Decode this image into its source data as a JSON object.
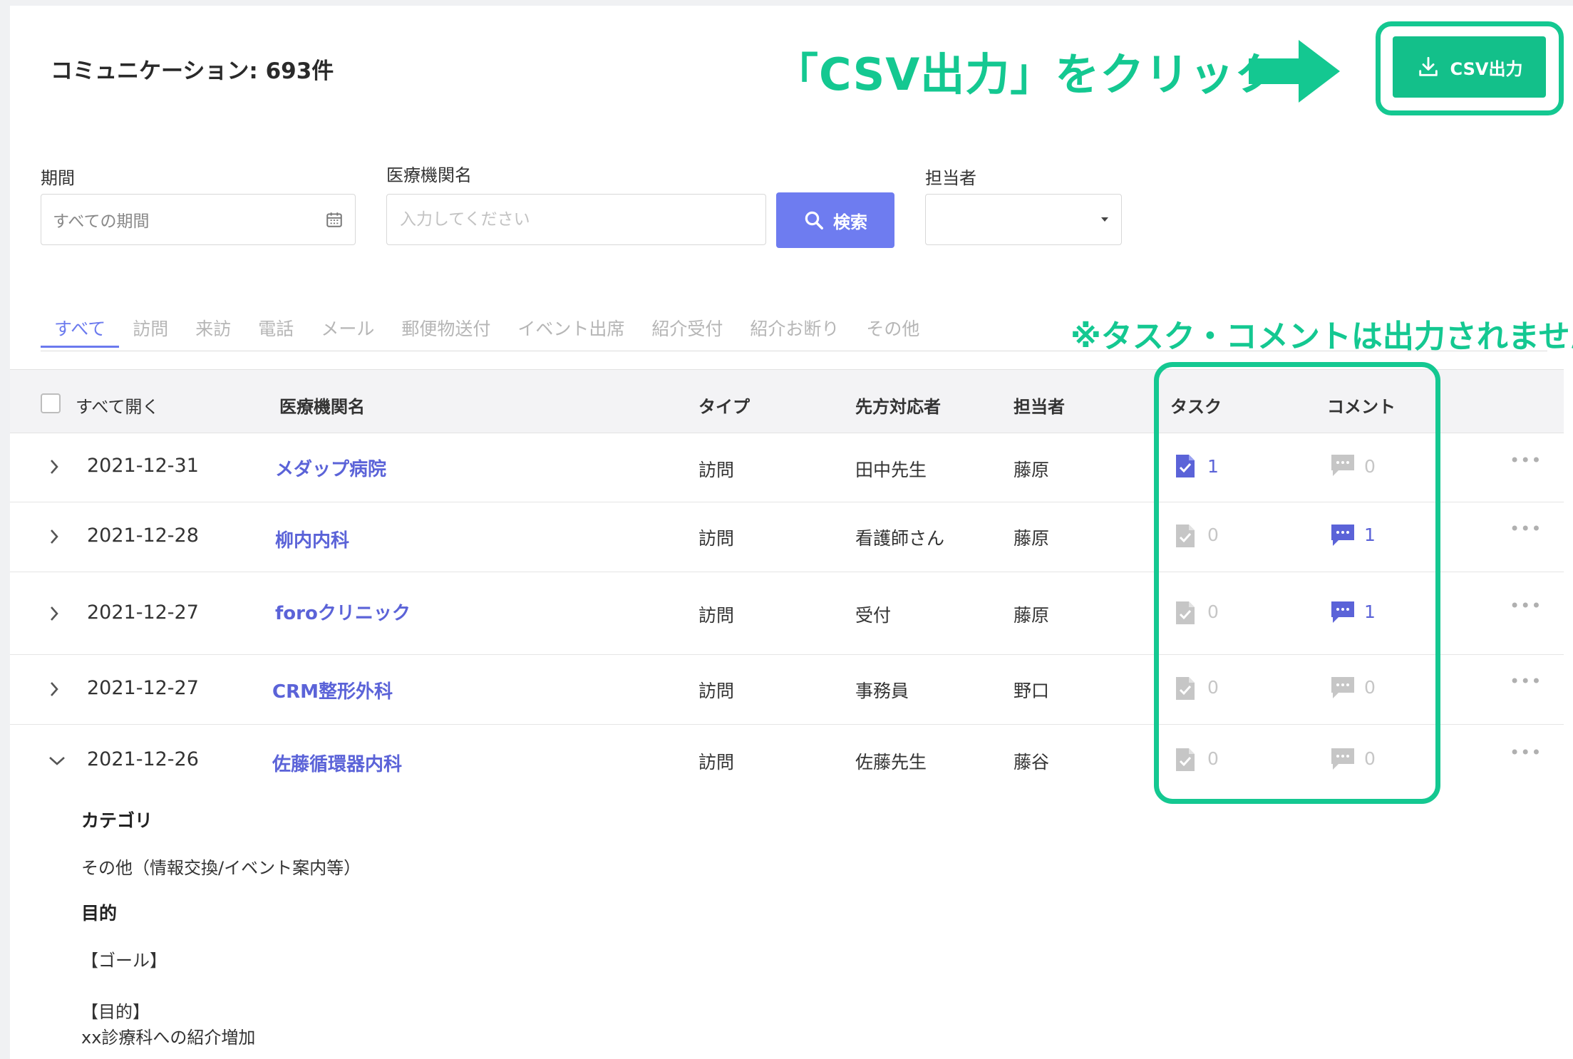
{
  "page_title": "コミュニケーション: 693件",
  "annotations": {
    "click_csv": "「CSV出力」をクリック",
    "note": "※タスク・コメントは出力されません",
    "accent_color": "#14c891"
  },
  "toolbar": {
    "csv_label": "CSV出力"
  },
  "filters": {
    "period_label": "期間",
    "period_value": "すべての期間",
    "institution_label": "医療機関名",
    "institution_placeholder": "入力してください",
    "search_label": "検索",
    "owner_label": "担当者",
    "owner_value": ""
  },
  "tabs": [
    {
      "label": "すべて",
      "active": true
    },
    {
      "label": "訪問"
    },
    {
      "label": "来訪"
    },
    {
      "label": "電話"
    },
    {
      "label": "メール"
    },
    {
      "label": "郵便物送付"
    },
    {
      "label": "イベント出席"
    },
    {
      "label": "紹介受付"
    },
    {
      "label": "紹介お断り"
    },
    {
      "label": "その他"
    }
  ],
  "table": {
    "expand_all": "すべて開く",
    "columns": {
      "institution": "医療機関名",
      "type": "タイプ",
      "contact": "先方対応者",
      "owner": "担当者",
      "task": "タスク",
      "comment": "コメント"
    },
    "rows": [
      {
        "date": "2021-12-31",
        "institution": "メダップ病院",
        "type": "訪問",
        "contact": "田中先生",
        "owner": "藤原",
        "tasks": "1",
        "comments": "0",
        "expanded": false
      },
      {
        "date": "2021-12-28",
        "institution": "柳内内科",
        "type": "訪問",
        "contact": "看護師さん",
        "owner": "藤原",
        "tasks": "0",
        "comments": "1",
        "expanded": false
      },
      {
        "date": "2021-12-27",
        "institution": "foroクリニック",
        "type": "訪問",
        "contact": "受付",
        "owner": "藤原",
        "tasks": "0",
        "comments": "1",
        "expanded": false
      },
      {
        "date": "2021-12-27",
        "institution": "CRM整形外科",
        "type": "訪問",
        "contact": "事務員",
        "owner": "野口",
        "tasks": "0",
        "comments": "0",
        "expanded": false
      },
      {
        "date": "2021-12-26",
        "institution": "佐藤循環器内科",
        "type": "訪問",
        "contact": "佐藤先生",
        "owner": "藤谷",
        "tasks": "0",
        "comments": "0",
        "expanded": true
      }
    ]
  },
  "detail": {
    "category_label": "カテゴリ",
    "category_value": "その他（情報交換/イベント案内等）",
    "purpose_label": "目的",
    "goal_heading": "【ゴール】",
    "purpose_heading": "【目的】",
    "purpose_value": "xx診療科への紹介増加"
  },
  "icons": {
    "csv": "download-icon",
    "calendar": "calendar-icon",
    "search": "search-icon",
    "dropdown": "caret-down-icon",
    "task": "task-document-icon",
    "comment": "comment-bubble-icon",
    "more": "more-horizontal-icon"
  },
  "colors": {
    "primary": "#6b7aee",
    "csv_button": "#13c08a",
    "link": "#5b63d8",
    "inactive": "#c6c6c6"
  }
}
